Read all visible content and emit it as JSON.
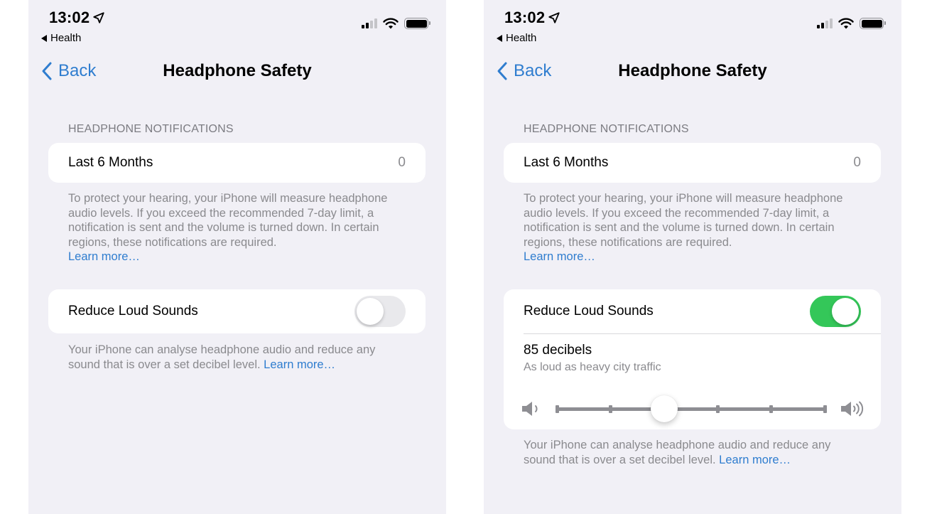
{
  "screens": {
    "left": {
      "status_bar": {
        "time": "13:02",
        "return_app": "Health",
        "signal_bars_active": 2,
        "signal_bars_total": 4
      },
      "nav": {
        "back_label": "Back",
        "title": "Headphone Safety"
      },
      "notifications": {
        "header": "HEADPHONE NOTIFICATIONS",
        "row_label": "Last 6 Months",
        "row_value": "0",
        "footer": "To protect your hearing, your iPhone will measure headphone audio levels. If you exceed the recommended 7-day limit, a notification is sent and the volume is turned down. In certain regions, these notifications are required.",
        "footer_link": "Learn more…"
      },
      "reduce_loud_sounds": {
        "label": "Reduce Loud Sounds",
        "enabled": false,
        "footer": "Your iPhone can analyse headphone audio and reduce any sound that is over a set decibel level.",
        "footer_link": "Learn more…"
      }
    },
    "right": {
      "status_bar": {
        "time": "13:02",
        "return_app": "Health",
        "signal_bars_active": 2,
        "signal_bars_total": 4
      },
      "nav": {
        "back_label": "Back",
        "title": "Headphone Safety"
      },
      "notifications": {
        "header": "HEADPHONE NOTIFICATIONS",
        "row_label": "Last 6 Months",
        "row_value": "0",
        "footer": "To protect your hearing, your iPhone will measure headphone audio levels. If you exceed the recommended 7-day limit, a notification is sent and the volume is turned down. In certain regions, these notifications are required.",
        "footer_link": "Learn more…"
      },
      "reduce_loud_sounds": {
        "label": "Reduce Loud Sounds",
        "enabled": true,
        "level_label": "85 decibels",
        "level_description": "As loud as heavy city traffic",
        "slider": {
          "steps": 6,
          "selected_index": 2
        },
        "footer": "Your iPhone can analyse headphone audio and reduce any sound that is over a set decibel level.",
        "footer_link": "Learn more…"
      }
    }
  },
  "colors": {
    "accent": "#2f7dcf",
    "toggle_on": "#34c759",
    "toggle_off": "#e9e9ec",
    "background": "#f1f0f6",
    "secondary_text": "#8a8a8e"
  },
  "icons": {
    "location": "location-arrow-icon",
    "signal": "cellular-signal-icon",
    "wifi": "wifi-icon",
    "battery": "battery-icon",
    "back": "chevron-left-icon",
    "speaker_low": "speaker-low-icon",
    "speaker_high": "speaker-high-icon"
  }
}
